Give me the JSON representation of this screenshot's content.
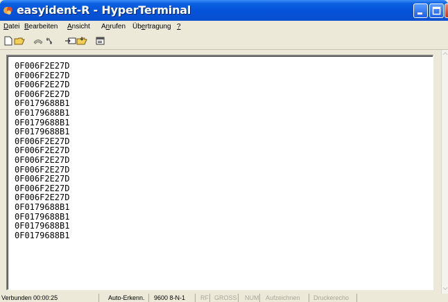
{
  "window": {
    "title": "easyident-R - HyperTerminal",
    "icon": "hyperterminal-app-icon"
  },
  "menu": [
    {
      "label": "Datei",
      "accel": "D"
    },
    {
      "label": "Bearbeiten",
      "accel": "B"
    },
    {
      "label": "Ansicht",
      "accel": "A"
    },
    {
      "label": "Anrufen",
      "accel": "n"
    },
    {
      "label": "Übertragung",
      "accel": "e"
    },
    {
      "label": "?",
      "accel": "?"
    }
  ],
  "toolbar": {
    "buttons": [
      "new-document-icon",
      "open-folder-icon",
      "connect-phone-icon",
      "disconnect-phone-icon",
      "send-icon",
      "receive-icon",
      "properties-icon"
    ]
  },
  "terminal": {
    "lines": [
      "0F006F2E27D",
      "0F006F2E27D",
      "0F006F2E27D",
      "0F006F2E27D",
      "0F0179688B1",
      "0F0179688B1",
      "0F0179688B1",
      "0F0179688B1",
      "0F006F2E27D",
      "0F006F2E27D",
      "0F006F2E27D",
      "0F006F2E27D",
      "0F006F2E27D",
      "0F006F2E27D",
      "0F006F2E27D",
      "0F0179688B1",
      "0F0179688B1",
      "0F0179688B1",
      "0F0179688B1"
    ]
  },
  "status": {
    "connected": "Verbunden 00:00:25",
    "detect": "Auto-Erkenn.",
    "port": "9600 8-N-1",
    "rf": "RF",
    "caps": "GROSS",
    "num": "NUM",
    "capture": "Aufzeichnen",
    "print_echo": "Druckerecho"
  }
}
